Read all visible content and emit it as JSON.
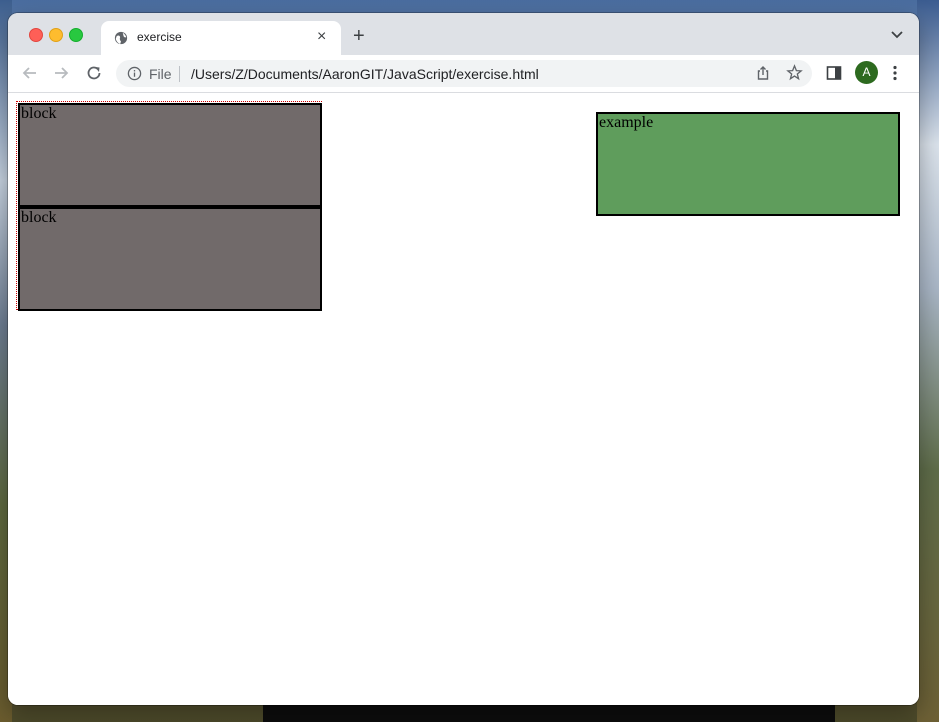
{
  "browser": {
    "tab": {
      "title": "exercise",
      "favicon": "globe-icon"
    },
    "new_tab_label": "+",
    "close_tab_label": "×",
    "address_bar": {
      "scheme_label": "File",
      "url": "/Users/Z/Documents/AaronGIT/JavaScript/exercise.html"
    },
    "profile_initial": "A",
    "colors": {
      "profile": "#2d6a1f",
      "tabstrip": "#dee1e6"
    }
  },
  "page": {
    "blocks": [
      {
        "label": "block",
        "color": "#716a6a"
      },
      {
        "label": "block",
        "color": "#716a6a"
      }
    ],
    "example": {
      "label": "example",
      "color": "#5f9d5c"
    },
    "container_border_color": "#cc0000"
  }
}
